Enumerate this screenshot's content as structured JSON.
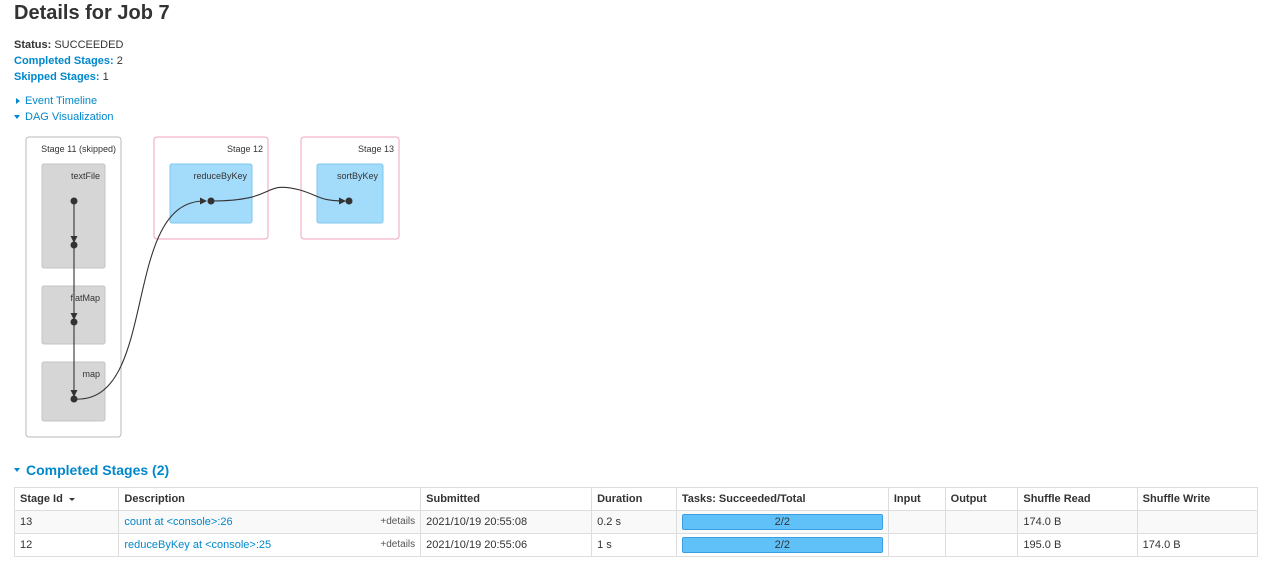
{
  "page": {
    "title": "Details for Job 7"
  },
  "summary": {
    "status_label": "Status:",
    "status_value": "SUCCEEDED",
    "completed_label": "Completed Stages:",
    "completed_value": "2",
    "skipped_label": "Skipped Stages:",
    "skipped_value": "1"
  },
  "toggles": {
    "event_timeline": "Event Timeline",
    "dag_visualization": "DAG Visualization"
  },
  "dag": {
    "stages": [
      {
        "label": "Stage 11 (skipped)",
        "state": "skipped",
        "ops": [
          "textFile",
          "flatMap",
          "map"
        ]
      },
      {
        "label": "Stage 12",
        "state": "active",
        "ops": [
          "reduceByKey"
        ]
      },
      {
        "label": "Stage 13",
        "state": "active",
        "ops": [
          "sortByKey"
        ]
      }
    ]
  },
  "completed_section": {
    "title": "Completed Stages (2)"
  },
  "table": {
    "headers": [
      "Stage Id",
      "Description",
      "Submitted",
      "Duration",
      "Tasks: Succeeded/Total",
      "Input",
      "Output",
      "Shuffle Read",
      "Shuffle Write"
    ],
    "sorted_column": "Stage Id",
    "rows": [
      {
        "stage_id": "13",
        "description": "count at <console>:26",
        "details": "+details",
        "submitted": "2021/10/19 20:55:08",
        "duration": "0.2 s",
        "tasks": "2/2",
        "tasks_progress": 1.0,
        "input": "",
        "output": "",
        "shuffle_read": "174.0 B",
        "shuffle_write": ""
      },
      {
        "stage_id": "12",
        "description": "reduceByKey at <console>:25",
        "details": "+details",
        "submitted": "2021/10/19 20:55:06",
        "duration": "1 s",
        "tasks": "2/2",
        "tasks_progress": 1.0,
        "input": "",
        "output": "",
        "shuffle_read": "195.0 B",
        "shuffle_write": "174.0 B"
      }
    ]
  },
  "colors": {
    "link": "#0088cc",
    "skipped_fill": "#d6d6d6",
    "active_fill": "#a3dcfa",
    "stage_border_active": "#f0a3b8",
    "progress": "#4eb5f5"
  }
}
